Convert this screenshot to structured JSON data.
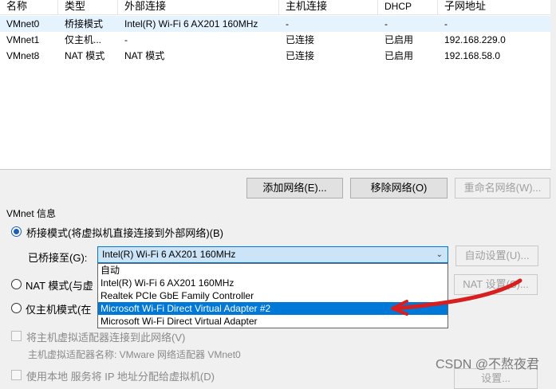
{
  "table": {
    "columns": [
      "名称",
      "类型",
      "外部连接",
      "主机连接",
      "DHCP",
      "子网地址"
    ],
    "rows": [
      [
        "VMnet0",
        "桥接模式",
        "Intel(R) Wi-Fi 6 AX201 160MHz",
        "-",
        "-",
        "-"
      ],
      [
        "VMnet1",
        "仅主机...",
        "-",
        "已连接",
        "已启用",
        "192.168.229.0"
      ],
      [
        "VMnet8",
        "NAT 模式",
        "NAT 模式",
        "已连接",
        "已启用",
        "192.168.58.0"
      ]
    ]
  },
  "buttons": {
    "add_network": "添加网络(E)...",
    "remove_network": "移除网络(O)",
    "rename_network": "重命名网络(W)...",
    "auto_settings": "自动设置(U)...",
    "nat_settings": "NAT 设置(S)...",
    "dhcp_settings": "设置..."
  },
  "vmnet_info": {
    "group_label": "VMnet 信息",
    "bridge_mode": "桥接模式(将虚拟机直接连接到外部网络)(B)",
    "bridged_to_label": "已桥接至(G):",
    "bridged_to_value": "Intel(R) Wi-Fi 6 AX201 160MHz",
    "nat_mode": "NAT 模式(与虚",
    "host_only": "仅主机模式(在",
    "connect_host_adapter": "将主机虚拟适配器连接到此网络(V)",
    "host_adapter_name": "主机虚拟适配器名称: VMware 网络适配器 VMnet0",
    "dhcp_partial": "使用本地      服务将 IP 地址分配给虚拟机(D)"
  },
  "dropdown_options": [
    "自动",
    "Intel(R) Wi-Fi 6 AX201 160MHz",
    "Realtek PCIe GbE Family Controller",
    "Microsoft Wi-Fi Direct Virtual Adapter #2",
    "Microsoft Wi-Fi Direct Virtual Adapter"
  ],
  "highlighted_option_index": 3,
  "watermark": "CSDN @不熬夜君",
  "colors": {
    "selection": "#0078d7",
    "row_highlight": "#e5f3ff",
    "annotation_arrow": "#d81e1e"
  }
}
